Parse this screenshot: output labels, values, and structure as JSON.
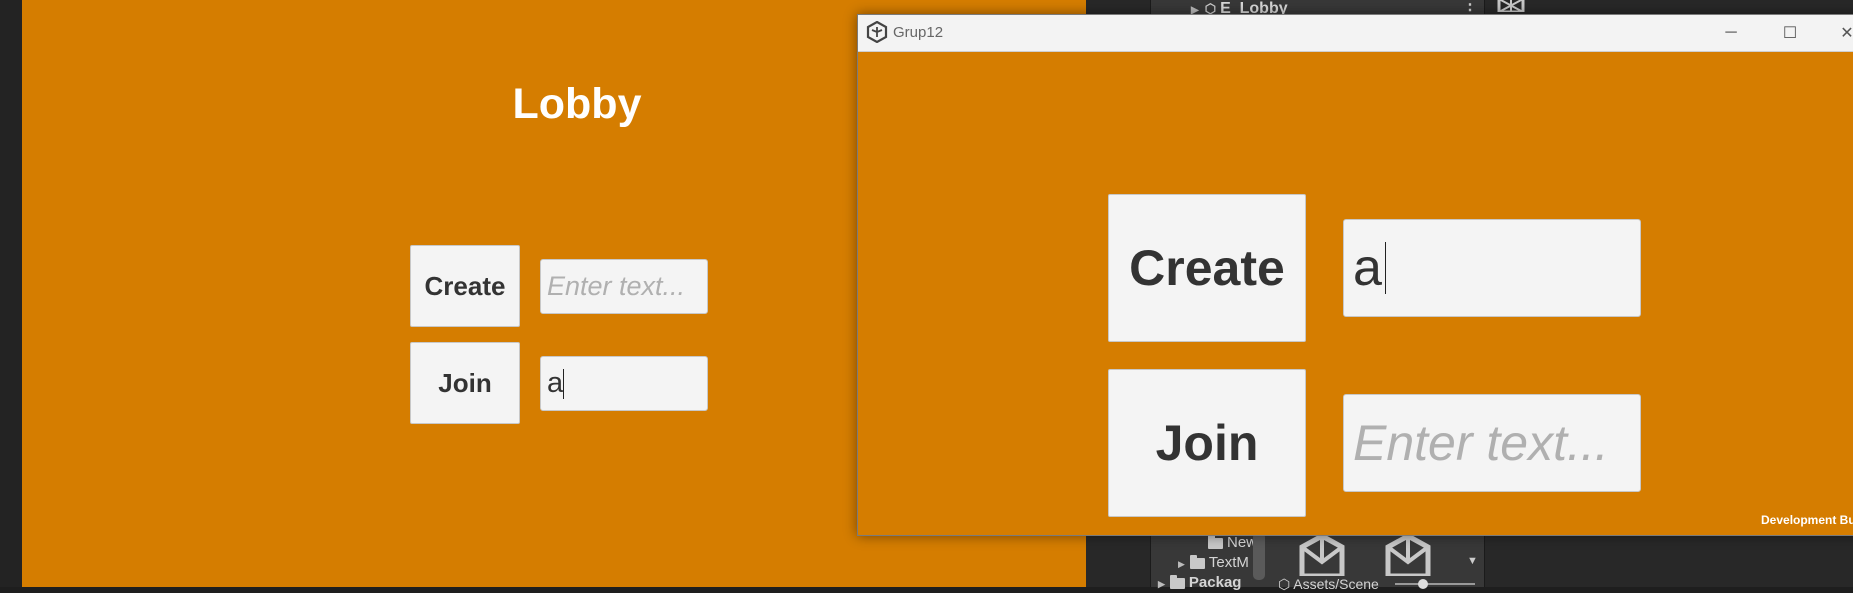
{
  "editor": {
    "hierarchy_item": "E_Lobby",
    "project_items": [
      "New",
      "TextM",
      "Packag"
    ],
    "project_breadcrumb": "Assets/Scene"
  },
  "lobby_view": {
    "title": "Lobby",
    "create_label": "Create",
    "join_label": "Join",
    "create_input": {
      "value": "",
      "placeholder": "Enter text..."
    },
    "join_input": {
      "value": "a",
      "placeholder": ""
    }
  },
  "game_window": {
    "title": "Grup12",
    "create_label": "Create",
    "join_label": "Join",
    "create_input": {
      "value": "a",
      "placeholder": ""
    },
    "join_input": {
      "value": "",
      "placeholder": "Enter text..."
    },
    "footer": "Development Bu",
    "controls": [
      "minimize-icon",
      "maximize-icon",
      "close-icon"
    ]
  },
  "colors": {
    "game_background": "#D57D00",
    "button_background": "#F4F4F4",
    "text_dark": "#333333",
    "placeholder": "#B0B0B0"
  }
}
